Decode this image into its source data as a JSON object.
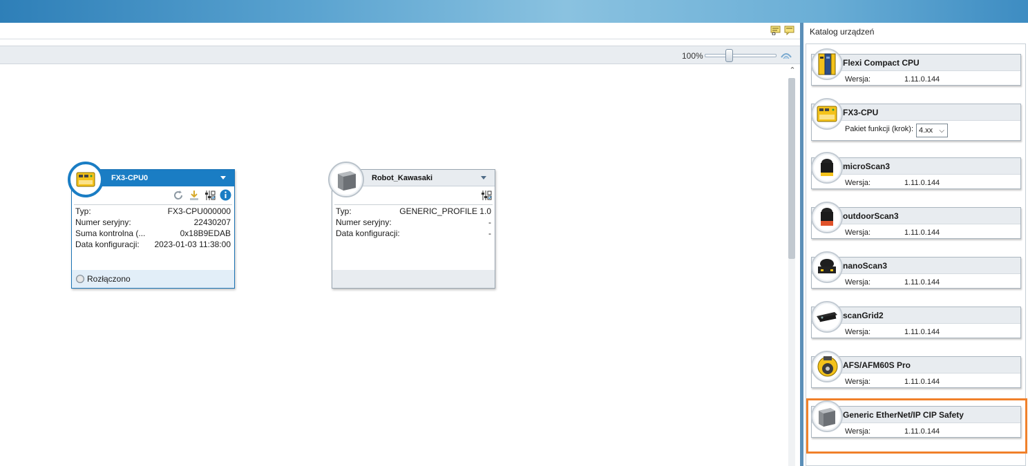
{
  "toolbar": {
    "zoom_label": "100%",
    "zoom_level_percent": 100
  },
  "devices": [
    {
      "name": "FX3-CPU0",
      "rows": [
        {
          "key": "Typ:",
          "value": "FX3-CPU000000"
        },
        {
          "key": "Numer seryjny:",
          "value": "22430207"
        },
        {
          "key": "Suma kontrolna (...",
          "value": "0x18B9EDAB"
        },
        {
          "key": "Data konfiguracji:",
          "value": "2023-01-03 11:38:00"
        }
      ],
      "status": "Rozłączono"
    },
    {
      "name": "Robot_Kawasaki",
      "rows": [
        {
          "key": "Typ:",
          "value": "GENERIC_PROFILE 1.0"
        },
        {
          "key": "Numer seryjny:",
          "value": "-"
        },
        {
          "key": "Data konfiguracji:",
          "value": "-"
        }
      ]
    }
  ],
  "catalog": {
    "title": "Katalog urządzeń",
    "items": [
      {
        "name": "Flexi Compact CPU",
        "key": "Wersja:",
        "value": "1.11.0.144",
        "icon": "flexi-compact-icon"
      },
      {
        "name": "FX3-CPU",
        "key": "Pakiet funkcji (krok):",
        "value": "4.xx",
        "icon": "fx3-cpu-icon"
      },
      {
        "name": "microScan3",
        "key": "Wersja:",
        "value": "1.11.0.144",
        "icon": "microscan3-icon"
      },
      {
        "name": "outdoorScan3",
        "key": "Wersja:",
        "value": "1.11.0.144",
        "icon": "outdoorscan3-icon"
      },
      {
        "name": "nanoScan3",
        "key": "Wersja:",
        "value": "1.11.0.144",
        "icon": "nanoscan3-icon"
      },
      {
        "name": "scanGrid2",
        "key": "Wersja:",
        "value": "1.11.0.144",
        "icon": "scangrid2-icon"
      },
      {
        "name": "AFS/AFM60S Pro",
        "key": "Wersja:",
        "value": "1.11.0.144",
        "icon": "encoder-icon"
      },
      {
        "name": "Generic EtherNet/IP CIP Safety",
        "key": "Wersja:",
        "value": "1.11.0.144",
        "icon": "generic-device-icon"
      }
    ]
  },
  "colors": {
    "accent": "#1a7dc4",
    "highlight": "#f0802a"
  }
}
